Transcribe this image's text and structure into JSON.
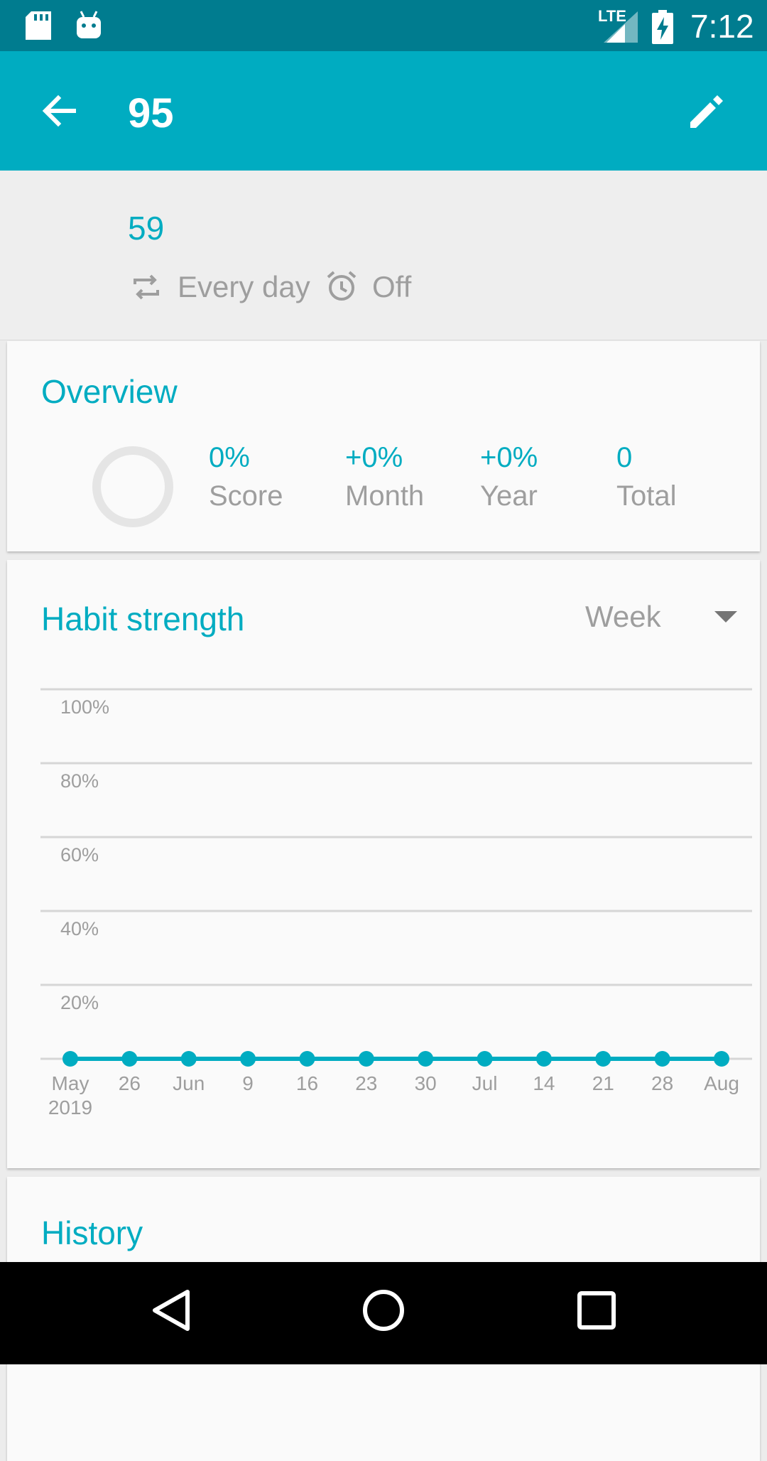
{
  "status_bar": {
    "network": "LTE",
    "time": "7:12",
    "icons": [
      "sd-card-icon",
      "android-debug-icon",
      "signal-icon",
      "battery-charging-icon"
    ]
  },
  "app_bar": {
    "title": "95",
    "icons": [
      "back-arrow-icon",
      "edit-pencil-icon"
    ]
  },
  "habit": {
    "description": "59",
    "repetition": "Every day",
    "reminder": "Off"
  },
  "overview": {
    "title": "Overview",
    "score_ring_percent": 0,
    "stats": [
      {
        "value": "0%",
        "label": "Score"
      },
      {
        "value": "+0%",
        "label": "Month"
      },
      {
        "value": "+0%",
        "label": "Year"
      },
      {
        "value": "0",
        "label": "Total"
      }
    ]
  },
  "habit_strength": {
    "title": "Habit strength",
    "period": "Week"
  },
  "chart_data": {
    "type": "line",
    "y_ticks": [
      "100%",
      "80%",
      "60%",
      "40%",
      "20%"
    ],
    "ylim": [
      0,
      100
    ],
    "categories": [
      "May",
      "26",
      "Jun",
      "9",
      "16",
      "23",
      "30",
      "Jul",
      "14",
      "21",
      "28",
      "Aug"
    ],
    "year_label": "2019",
    "values": [
      0,
      0,
      0,
      0,
      0,
      0,
      0,
      0,
      0,
      0,
      0,
      0
    ],
    "grid": true,
    "color": "#00acc1"
  },
  "history": {
    "title": "History"
  },
  "colors": {
    "primary": "#00acc1",
    "primary_dark": "#007c8f",
    "secondary_text": "#9e9e9e"
  }
}
